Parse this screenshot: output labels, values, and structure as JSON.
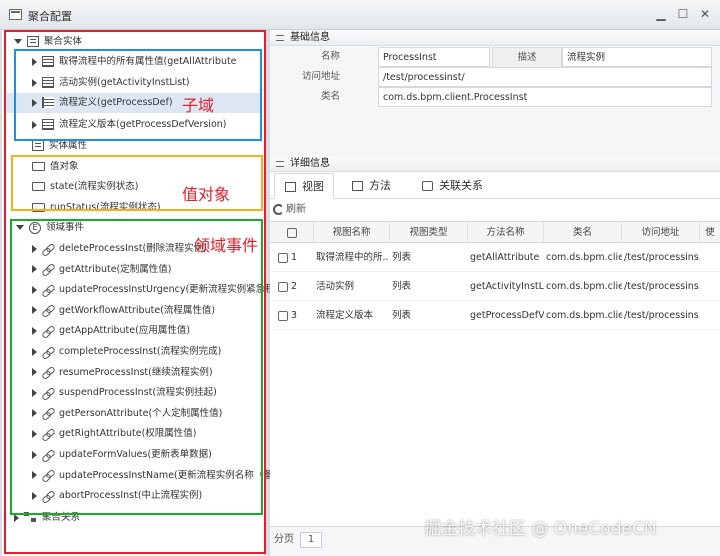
{
  "window": {
    "title": "聚合配置",
    "minimize_glyph": "▁",
    "maximize_glyph": "☐",
    "close_glyph": "✕"
  },
  "tree": {
    "aggregate_entity": "聚合实体",
    "sub_items": [
      "取得流程中的所有属性值(getAllAttribute",
      "活动实例(getActivityInstList)",
      "流程定义(getProcessDef)",
      "流程定义版本(getProcessDefVersion)"
    ],
    "entity_attrs": "实体属性",
    "value_object": "值对象",
    "value_items": [
      "state(流程实例状态)",
      "runStatus(流程实例状态)"
    ],
    "domain_events": "领域事件",
    "event_items": [
      "deleteProcessInst(删除流程实例)",
      "getAttribute(定制属性值)",
      "updateProcessInstUrgency(更新流程实例紧急程",
      "getWorkflowAttribute(流程属性值)",
      "getAppAttribute(应用属性值)",
      "completeProcessInst(流程实例完成)",
      "resumeProcessInst(继续流程实例)",
      "suspendProcessInst(流程实例挂起)",
      "getPersonAttribute(个人定制属性值)",
      "getRightAttribute(权限属性值)",
      "updateFormValues(更新表单数据)",
      "updateProcessInstName(更新流程实例名称（备",
      "abortProcessInst(中止流程实例)"
    ],
    "aggregate_relations": "聚合关系"
  },
  "annotations": {
    "subdomain": "子域",
    "value_object": "值对象",
    "domain_events": "领域事件"
  },
  "colors": {
    "red": "#e0202a",
    "blue": "#1f8fe0",
    "yellow": "#f2b01e",
    "green": "#1aaa2a"
  },
  "basic": {
    "header": "基础信息",
    "name_label": "名称",
    "name_value": "ProcessInst",
    "desc_label": "描述",
    "desc_value": "流程实例",
    "url_label": "访问地址",
    "url_value": "/test/processinst/",
    "class_label": "类名",
    "class_value": "com.ds.bpm.client.ProcessInst"
  },
  "detail": {
    "header": "详细信息",
    "tabs": [
      "视图",
      "方法",
      "关联关系"
    ],
    "refresh": "刷新",
    "columns": [
      "视图名称",
      "视图类型",
      "方法名称",
      "类名",
      "访问地址",
      "使"
    ],
    "rows": [
      {
        "no": "1",
        "name": "取得流程中的所...",
        "type": "列表",
        "method": "getAllAttribute",
        "cls": "com.ds.bpm.clie...",
        "url": "/test/processins..."
      },
      {
        "no": "2",
        "name": "活动实例",
        "type": "列表",
        "method": "getActivityInstList",
        "cls": "com.ds.bpm.clie...",
        "url": "/test/processins..."
      },
      {
        "no": "3",
        "name": "流程定义版本",
        "type": "列表",
        "method": "getProcessDefV...",
        "cls": "com.ds.bpm.clie...",
        "url": "/test/processins..."
      }
    ],
    "pager_label": "分页",
    "page": "1"
  },
  "watermark": "掘金技术社区 @ OneCodeCN"
}
